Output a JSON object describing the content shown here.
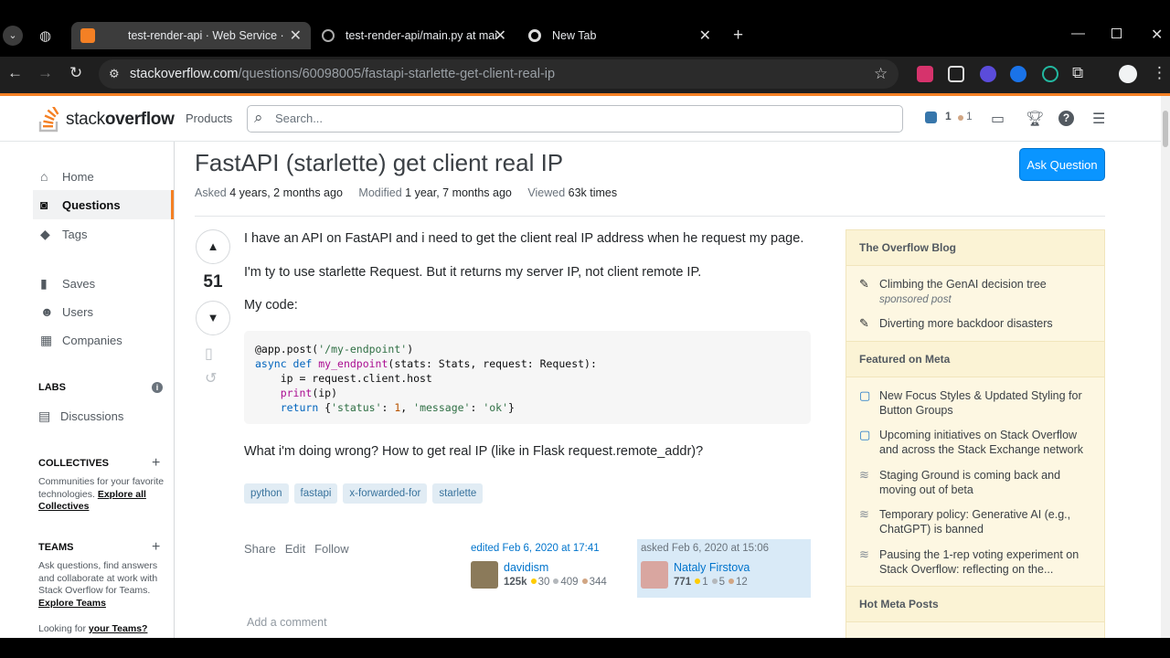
{
  "browser": {
    "tabs": [
      {
        "title": "test-render-api · Web Service ·"
      },
      {
        "title": "test-render-api/main.py at mai"
      },
      {
        "title": "New Tab"
      }
    ],
    "url_host": "stackoverflow.com",
    "url_path": "/questions/60098005/fastapi-starlette-get-client-real-ip"
  },
  "header": {
    "logo_plain": "stack",
    "logo_bold": "overflow",
    "products": "Products",
    "search_placeholder": "Search...",
    "rep": "1",
    "bronze": "1"
  },
  "leftnav": {
    "home": "Home",
    "questions": "Questions",
    "tags": "Tags",
    "saves": "Saves",
    "users": "Users",
    "companies": "Companies",
    "labs": "LABS",
    "discussions": "Discussions",
    "collectives_head": "COLLECTIVES",
    "collectives_text": "Communities for your favorite technologies.",
    "collectives_link": "Explore all Collectives",
    "teams_head": "TEAMS",
    "teams_text": "Ask questions, find answers and collaborate at work with Stack Overflow for Teams.",
    "teams_link": "Explore Teams",
    "looking_text": "Looking for",
    "looking_link": "your Teams?"
  },
  "question": {
    "title": "FastAPI (starlette) get client real IP",
    "asked_label": "Asked",
    "asked_value": "4 years, 2 months ago",
    "modified_label": "Modified",
    "modified_value": "1 year, 7 months ago",
    "viewed_label": "Viewed",
    "viewed_value": "63k times",
    "ask_button": "Ask Question",
    "score": "51",
    "p1": "I have an API on FastAPI and i need to get the client real IP address when he request my page.",
    "p2": "I'm ty to use starlette Request. But it returns my server IP, not client remote IP.",
    "p3": "My code:",
    "p4": "What i'm doing wrong? How to get real IP (like in Flask request.remote_addr)?",
    "tags": [
      "python",
      "fastapi",
      "x-forwarded-for",
      "starlette"
    ],
    "share": "Share",
    "edit": "Edit",
    "follow": "Follow",
    "edited_label": "edited Feb 6, 2020 at 17:41",
    "editor_name": "davidism",
    "editor_rep": "125k",
    "editor_gold": "30",
    "editor_silver": "409",
    "editor_bronze": "344",
    "asked_sig": "asked Feb 6, 2020 at 15:06",
    "owner_name": "Nataly Firstova",
    "owner_rep": "771",
    "owner_gold": "1",
    "owner_silver": "5",
    "owner_bronze": "12",
    "add_comment": "Add a comment"
  },
  "sidebar": {
    "blog_head": "The Overflow Blog",
    "blog_1": "Climbing the GenAI decision tree",
    "blog_1_sub": "sponsored post",
    "blog_2": "Diverting more backdoor disasters",
    "meta_head": "Featured on Meta",
    "meta_1": "New Focus Styles & Updated Styling for Button Groups",
    "meta_2": "Upcoming initiatives on Stack Overflow and across the Stack Exchange network",
    "meta_3": "Staging Ground is coming back and moving out of beta",
    "meta_4": "Temporary policy: Generative AI (e.g., ChatGPT) is banned",
    "meta_5": "Pausing the 1-rep voting experiment on Stack Overflow: reflecting on the...",
    "hot_head": "Hot Meta Posts"
  }
}
